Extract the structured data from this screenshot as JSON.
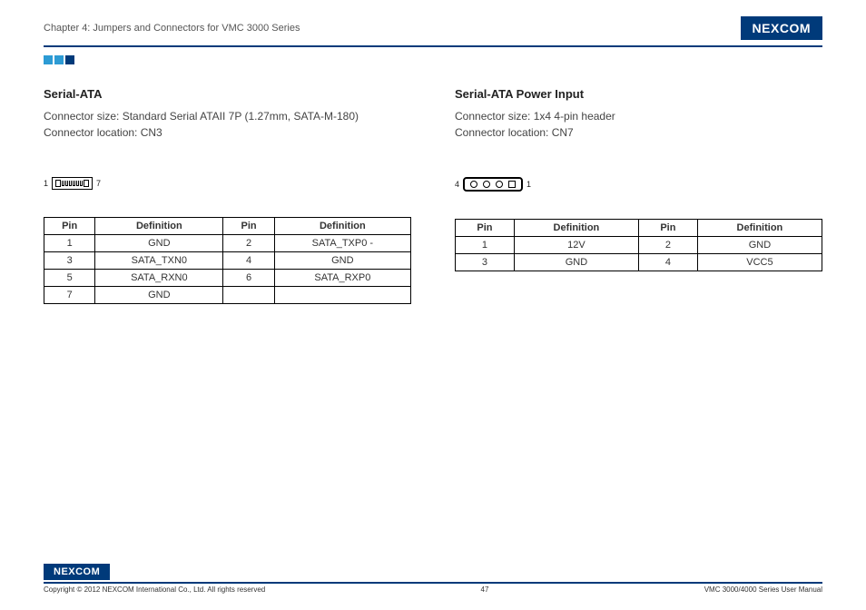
{
  "header": {
    "chapter": "Chapter 4: Jumpers and Connectors for VMC 3000 Series",
    "logo": "NEXCOM"
  },
  "left": {
    "title": "Serial-ATA",
    "size": "Connector size: Standard Serial ATAII 7P (1.27mm, SATA-M-180)",
    "loc": "Connector location: CN3",
    "diag_left": "1",
    "diag_right": "7",
    "headers": {
      "pin": "Pin",
      "def": "Definition"
    },
    "rows": [
      {
        "p1": "1",
        "d1": "GND",
        "p2": "2",
        "d2": "SATA_TXP0 -"
      },
      {
        "p1": "3",
        "d1": "SATA_TXN0",
        "p2": "4",
        "d2": "GND"
      },
      {
        "p1": "5",
        "d1": "SATA_RXN0",
        "p2": "6",
        "d2": "SATA_RXP0"
      },
      {
        "p1": "7",
        "d1": "GND",
        "p2": "",
        "d2": ""
      }
    ]
  },
  "right": {
    "title": "Serial-ATA Power Input",
    "size": "Connector size: 1x4 4-pin header",
    "loc": "Connector location: CN7",
    "diag_left": "4",
    "diag_right": "1",
    "headers": {
      "pin": "Pin",
      "def": "Definition"
    },
    "rows": [
      {
        "p1": "1",
        "d1": "12V",
        "p2": "2",
        "d2": "GND"
      },
      {
        "p1": "3",
        "d1": "GND",
        "p2": "4",
        "d2": "VCC5"
      }
    ]
  },
  "footer": {
    "logo": "NEXCOM",
    "copyright": "Copyright © 2012 NEXCOM International Co., Ltd. All rights reserved",
    "page": "47",
    "manual": "VMC 3000/4000 Series User Manual"
  }
}
